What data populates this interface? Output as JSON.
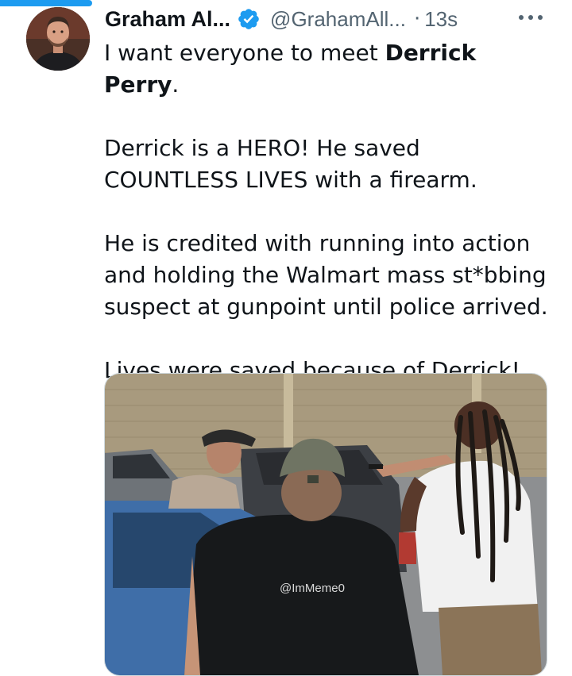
{
  "tweet": {
    "author_name": "Graham Al...",
    "handle": "@GrahamAll...",
    "separator": "·",
    "timestamp": "13s",
    "more": "•••",
    "intro_plain": "I want everyone to meet ",
    "intro_bold": "Derrick Perry",
    "intro_end": ".",
    "paragraph_2_line_1": "Derrick is a HERO! He saved",
    "paragraph_2_line_2": "COUNTLESS LIVES with a firearm.",
    "paragraph_3_line_1": "He is credited with running into action",
    "paragraph_3_line_2": "and holding the Walmart mass st*bbing",
    "paragraph_3_line_3": "suspect at gunpoint until police arrived.",
    "paragraph_4": "Lives were saved because of Derrick!",
    "media_watermark": "@ImMeme0"
  },
  "colors": {
    "accent": "#1d9bf0",
    "text_primary": "#0f1419",
    "text_secondary": "#536471",
    "border": "#cfd9de"
  },
  "icons": {
    "verified": "verified-badge-icon",
    "more": "more-horizontal-icon"
  }
}
